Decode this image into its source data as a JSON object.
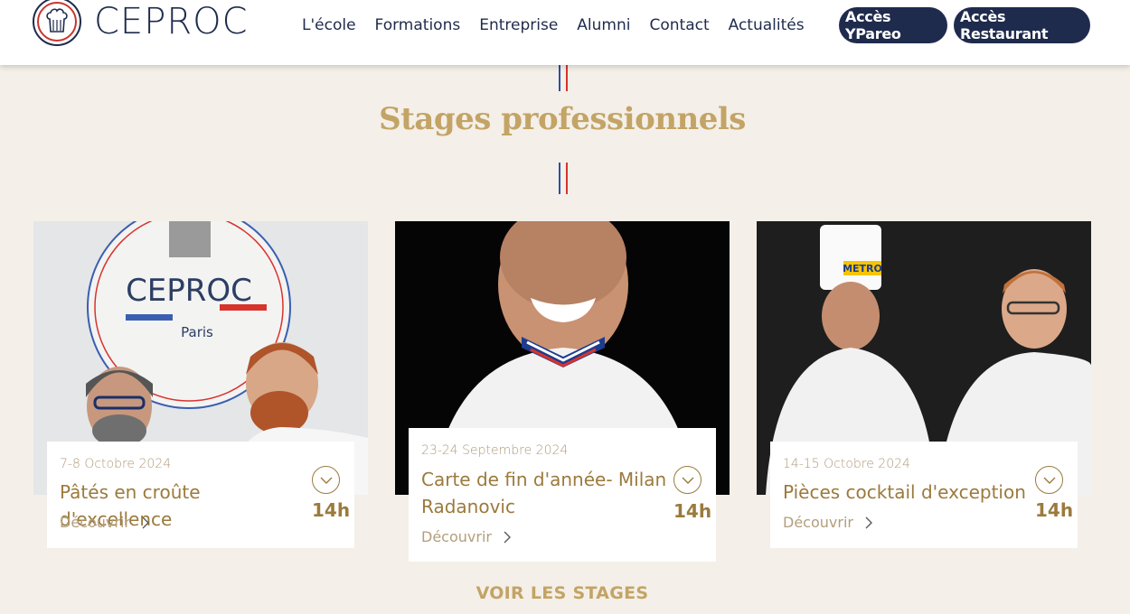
{
  "brand": {
    "name": "CEPROC",
    "logo_icon": "chef-hat-logo-icon"
  },
  "nav": {
    "items": [
      {
        "label": "L'école"
      },
      {
        "label": "Formations"
      },
      {
        "label": "Entreprise"
      },
      {
        "label": "Alumni"
      },
      {
        "label": "Contact"
      },
      {
        "label": "Actualités"
      }
    ]
  },
  "buttons": {
    "ypareo": "Accès YPareo",
    "restaurant": "Accès Restaurant"
  },
  "section": {
    "title": "Stages professionnels"
  },
  "cards": [
    {
      "date": "7-8 Octobre 2024",
      "title": "Pâtés en croûte d'excellence",
      "duration": "14h",
      "link": "Découvrir",
      "image_icon": "chefs-ceproc-photo"
    },
    {
      "date": "23-24 Septembre 2024",
      "title": "Carte de fin d'année- Milan Radanovic",
      "duration": "14h",
      "link": "Découvrir",
      "image_icon": "chef-milan-photo"
    },
    {
      "date": "14-15 Octobre 2024",
      "title": "Pièces cocktail d'exception",
      "duration": "14h",
      "link": "Découvrir",
      "image_icon": "chefs-metro-photo"
    }
  ],
  "cta": {
    "label": "VOIR LES STAGES"
  },
  "colors": {
    "navy": "#1f2b4d",
    "gold": "#c3a466",
    "bronze": "#9b7a3c",
    "background": "#f4efe8",
    "french_blue": "#2a4fa8",
    "french_red": "#d8332c"
  }
}
